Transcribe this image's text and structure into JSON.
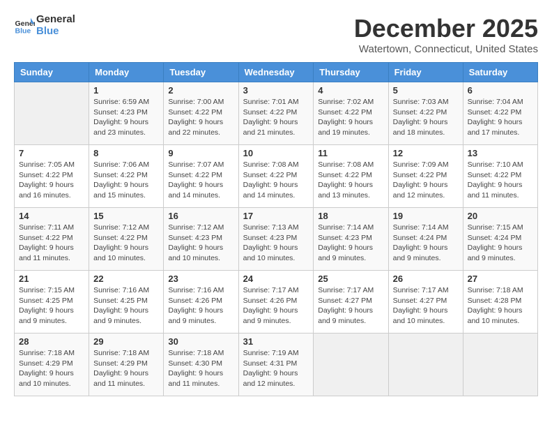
{
  "header": {
    "logo_general": "General",
    "logo_blue": "Blue",
    "month_year": "December 2025",
    "location": "Watertown, Connecticut, United States"
  },
  "days_of_week": [
    "Sunday",
    "Monday",
    "Tuesday",
    "Wednesday",
    "Thursday",
    "Friday",
    "Saturday"
  ],
  "weeks": [
    [
      {
        "day": "",
        "sunrise": "",
        "sunset": "",
        "daylight": ""
      },
      {
        "day": "1",
        "sunrise": "Sunrise: 6:59 AM",
        "sunset": "Sunset: 4:23 PM",
        "daylight": "Daylight: 9 hours and 23 minutes."
      },
      {
        "day": "2",
        "sunrise": "Sunrise: 7:00 AM",
        "sunset": "Sunset: 4:22 PM",
        "daylight": "Daylight: 9 hours and 22 minutes."
      },
      {
        "day": "3",
        "sunrise": "Sunrise: 7:01 AM",
        "sunset": "Sunset: 4:22 PM",
        "daylight": "Daylight: 9 hours and 21 minutes."
      },
      {
        "day": "4",
        "sunrise": "Sunrise: 7:02 AM",
        "sunset": "Sunset: 4:22 PM",
        "daylight": "Daylight: 9 hours and 19 minutes."
      },
      {
        "day": "5",
        "sunrise": "Sunrise: 7:03 AM",
        "sunset": "Sunset: 4:22 PM",
        "daylight": "Daylight: 9 hours and 18 minutes."
      },
      {
        "day": "6",
        "sunrise": "Sunrise: 7:04 AM",
        "sunset": "Sunset: 4:22 PM",
        "daylight": "Daylight: 9 hours and 17 minutes."
      }
    ],
    [
      {
        "day": "7",
        "sunrise": "Sunrise: 7:05 AM",
        "sunset": "Sunset: 4:22 PM",
        "daylight": "Daylight: 9 hours and 16 minutes."
      },
      {
        "day": "8",
        "sunrise": "Sunrise: 7:06 AM",
        "sunset": "Sunset: 4:22 PM",
        "daylight": "Daylight: 9 hours and 15 minutes."
      },
      {
        "day": "9",
        "sunrise": "Sunrise: 7:07 AM",
        "sunset": "Sunset: 4:22 PM",
        "daylight": "Daylight: 9 hours and 14 minutes."
      },
      {
        "day": "10",
        "sunrise": "Sunrise: 7:08 AM",
        "sunset": "Sunset: 4:22 PM",
        "daylight": "Daylight: 9 hours and 14 minutes."
      },
      {
        "day": "11",
        "sunrise": "Sunrise: 7:08 AM",
        "sunset": "Sunset: 4:22 PM",
        "daylight": "Daylight: 9 hours and 13 minutes."
      },
      {
        "day": "12",
        "sunrise": "Sunrise: 7:09 AM",
        "sunset": "Sunset: 4:22 PM",
        "daylight": "Daylight: 9 hours and 12 minutes."
      },
      {
        "day": "13",
        "sunrise": "Sunrise: 7:10 AM",
        "sunset": "Sunset: 4:22 PM",
        "daylight": "Daylight: 9 hours and 11 minutes."
      }
    ],
    [
      {
        "day": "14",
        "sunrise": "Sunrise: 7:11 AM",
        "sunset": "Sunset: 4:22 PM",
        "daylight": "Daylight: 9 hours and 11 minutes."
      },
      {
        "day": "15",
        "sunrise": "Sunrise: 7:12 AM",
        "sunset": "Sunset: 4:22 PM",
        "daylight": "Daylight: 9 hours and 10 minutes."
      },
      {
        "day": "16",
        "sunrise": "Sunrise: 7:12 AM",
        "sunset": "Sunset: 4:23 PM",
        "daylight": "Daylight: 9 hours and 10 minutes."
      },
      {
        "day": "17",
        "sunrise": "Sunrise: 7:13 AM",
        "sunset": "Sunset: 4:23 PM",
        "daylight": "Daylight: 9 hours and 10 minutes."
      },
      {
        "day": "18",
        "sunrise": "Sunrise: 7:14 AM",
        "sunset": "Sunset: 4:23 PM",
        "daylight": "Daylight: 9 hours and 9 minutes."
      },
      {
        "day": "19",
        "sunrise": "Sunrise: 7:14 AM",
        "sunset": "Sunset: 4:24 PM",
        "daylight": "Daylight: 9 hours and 9 minutes."
      },
      {
        "day": "20",
        "sunrise": "Sunrise: 7:15 AM",
        "sunset": "Sunset: 4:24 PM",
        "daylight": "Daylight: 9 hours and 9 minutes."
      }
    ],
    [
      {
        "day": "21",
        "sunrise": "Sunrise: 7:15 AM",
        "sunset": "Sunset: 4:25 PM",
        "daylight": "Daylight: 9 hours and 9 minutes."
      },
      {
        "day": "22",
        "sunrise": "Sunrise: 7:16 AM",
        "sunset": "Sunset: 4:25 PM",
        "daylight": "Daylight: 9 hours and 9 minutes."
      },
      {
        "day": "23",
        "sunrise": "Sunrise: 7:16 AM",
        "sunset": "Sunset: 4:26 PM",
        "daylight": "Daylight: 9 hours and 9 minutes."
      },
      {
        "day": "24",
        "sunrise": "Sunrise: 7:17 AM",
        "sunset": "Sunset: 4:26 PM",
        "daylight": "Daylight: 9 hours and 9 minutes."
      },
      {
        "day": "25",
        "sunrise": "Sunrise: 7:17 AM",
        "sunset": "Sunset: 4:27 PM",
        "daylight": "Daylight: 9 hours and 9 minutes."
      },
      {
        "day": "26",
        "sunrise": "Sunrise: 7:17 AM",
        "sunset": "Sunset: 4:27 PM",
        "daylight": "Daylight: 9 hours and 10 minutes."
      },
      {
        "day": "27",
        "sunrise": "Sunrise: 7:18 AM",
        "sunset": "Sunset: 4:28 PM",
        "daylight": "Daylight: 9 hours and 10 minutes."
      }
    ],
    [
      {
        "day": "28",
        "sunrise": "Sunrise: 7:18 AM",
        "sunset": "Sunset: 4:29 PM",
        "daylight": "Daylight: 9 hours and 10 minutes."
      },
      {
        "day": "29",
        "sunrise": "Sunrise: 7:18 AM",
        "sunset": "Sunset: 4:29 PM",
        "daylight": "Daylight: 9 hours and 11 minutes."
      },
      {
        "day": "30",
        "sunrise": "Sunrise: 7:18 AM",
        "sunset": "Sunset: 4:30 PM",
        "daylight": "Daylight: 9 hours and 11 minutes."
      },
      {
        "day": "31",
        "sunrise": "Sunrise: 7:19 AM",
        "sunset": "Sunset: 4:31 PM",
        "daylight": "Daylight: 9 hours and 12 minutes."
      },
      {
        "day": "",
        "sunrise": "",
        "sunset": "",
        "daylight": ""
      },
      {
        "day": "",
        "sunrise": "",
        "sunset": "",
        "daylight": ""
      },
      {
        "day": "",
        "sunrise": "",
        "sunset": "",
        "daylight": ""
      }
    ]
  ]
}
